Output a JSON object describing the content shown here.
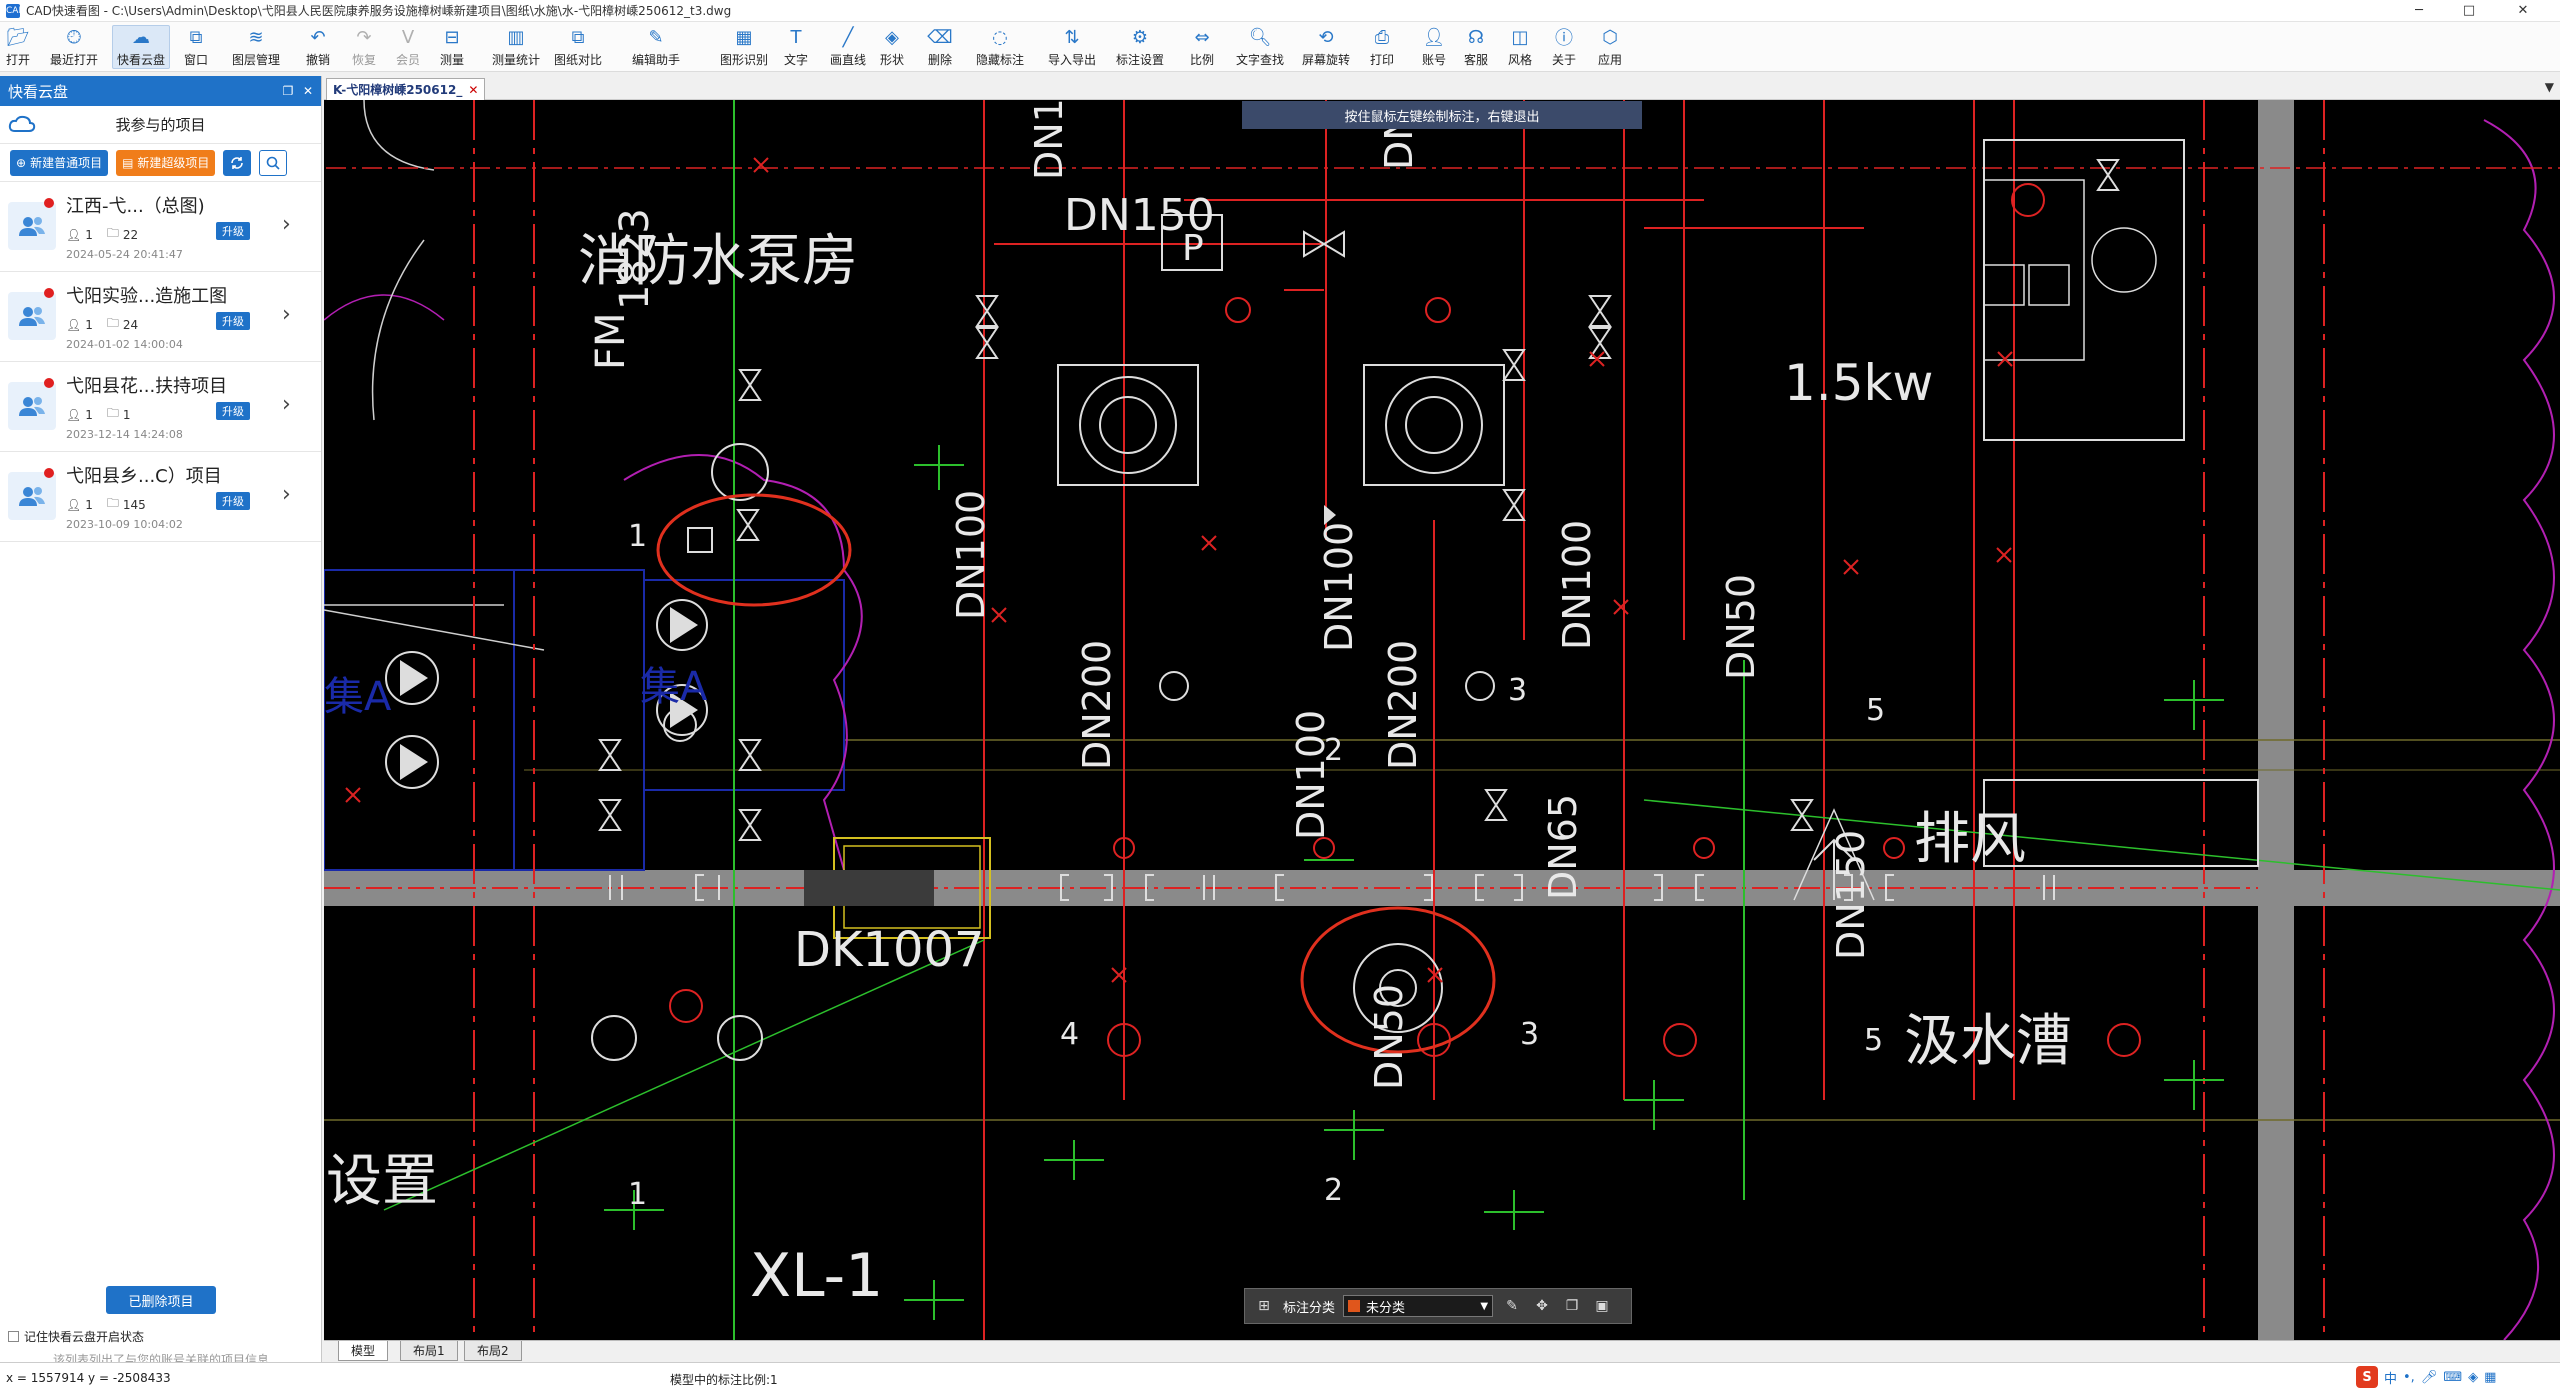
{
  "window": {
    "title": "CAD快速看图 - C:\\Users\\Admin\\Desktop\\弋阳县人民医院康养服务设施樟树嵊新建项目\\图纸\\水施\\水-弋阳樟树嵊250612_t3.dwg",
    "minimize": "─",
    "maximize": "□",
    "close": "✕"
  },
  "toolbar": [
    {
      "label": "打开",
      "icon": "open-folder-icon"
    },
    {
      "label": "最近打开",
      "icon": "recent-clock-icon"
    },
    {
      "label": "快看云盘",
      "icon": "cloud-icon",
      "active": true
    },
    {
      "label": "窗口",
      "icon": "window-icon"
    },
    {
      "label": "图层管理",
      "icon": "layers-icon"
    },
    {
      "label": "撤销",
      "icon": "undo-icon"
    },
    {
      "label": "恢复",
      "icon": "redo-icon",
      "disabled": true
    },
    {
      "label": "会员",
      "icon": "vip-icon",
      "disabled": true
    },
    {
      "label": "测量",
      "icon": "measure-icon"
    },
    {
      "label": "测量统计",
      "icon": "measure-stats-icon"
    },
    {
      "label": "图纸对比",
      "icon": "compare-icon"
    },
    {
      "label": "编辑助手",
      "icon": "edit-assistant-icon"
    },
    {
      "label": "图形识别",
      "icon": "shape-recognition-icon"
    },
    {
      "label": "文字",
      "icon": "text-icon"
    },
    {
      "label": "画直线",
      "icon": "line-icon"
    },
    {
      "label": "形状",
      "icon": "shape-icon"
    },
    {
      "label": "删除",
      "icon": "eraser-icon"
    },
    {
      "label": "隐藏标注",
      "icon": "hide-annotation-icon"
    },
    {
      "label": "导入导出",
      "icon": "import-export-icon"
    },
    {
      "label": "标注设置",
      "icon": "annotation-settings-icon"
    },
    {
      "label": "比例",
      "icon": "scale-icon"
    },
    {
      "label": "文字查找",
      "icon": "text-search-icon"
    },
    {
      "label": "屏幕旋转",
      "icon": "rotate-screen-icon"
    },
    {
      "label": "打印",
      "icon": "print-icon"
    },
    {
      "label": "账号",
      "icon": "account-icon"
    },
    {
      "label": "客服",
      "icon": "headset-icon"
    },
    {
      "label": "风格",
      "icon": "style-icon"
    },
    {
      "label": "关于",
      "icon": "info-icon"
    },
    {
      "label": "应用",
      "icon": "apps-cube-icon"
    }
  ],
  "cloud_panel": {
    "header": "快看云盘",
    "subtitle": "我参与的项目",
    "new_normal": "新建普通项目",
    "new_super": "新建超级项目",
    "projects": [
      {
        "name": "江西-弋...（总图)",
        "members": "1",
        "files": "22",
        "upgrade": "升级",
        "date": "2024-05-24 20:41:47"
      },
      {
        "name": "弋阳实验...造施工图",
        "members": "1",
        "files": "24",
        "upgrade": "升级",
        "date": "2024-01-02 14:00:04"
      },
      {
        "name": "弋阳县花...扶持项目",
        "members": "1",
        "files": "1",
        "upgrade": "升级",
        "date": "2023-12-14 14:24:08"
      },
      {
        "name": "弋阳县乡...C）项目",
        "members": "1",
        "files": "145",
        "upgrade": "升级",
        "date": "2023-10-09 10:04:02"
      }
    ],
    "deleted_projects": "已删除项目",
    "remember": "记住快看云盘开启状态",
    "hint": "该列表列出了与您的账号关联的项目信息"
  },
  "document_tab": {
    "label": "K-弋阳樟树嵊250612_",
    "close": "✕"
  },
  "canvas": {
    "tooltip": "按住鼠标左键绘制标注，右键退出",
    "labels": {
      "dn150_top": "DN150",
      "fm": "FM",
      "num_1823": "1823",
      "pump_room": "消防水泵房",
      "kw": "1.5kw",
      "dn100_a": "DN100",
      "dn100_b": "DN100",
      "dn100_c": "DN100",
      "dn100_d": "DN100",
      "dn50_a": "DN50",
      "dn50_b": "DN50",
      "dn200_a": "DN200",
      "dn200_b": "DN200",
      "dn65": "DN65",
      "dn150_b": "DN150",
      "dn_top1": "DN1",
      "dn_top2": "DN",
      "dk": "DK1007",
      "exhaust": "排风",
      "sump": "汲水漕",
      "setup": "设置",
      "xl": "XL-1",
      "jia_a": "集A",
      "jia_b": "集A",
      "p": "P",
      "n1": "1",
      "n2": "2",
      "n3": "3",
      "n3b": "3",
      "n4": "4",
      "n5": "5",
      "n5b": "5",
      "n1b": "1",
      "n2b": "2"
    },
    "annotation_bar": {
      "label": "标注分类",
      "value": "未分类"
    }
  },
  "layout_tabs": [
    "模型",
    "布局1",
    "布局2"
  ],
  "status": {
    "coords": "x = 1557914  y = -2508433",
    "scale": "模型中的标注比例:1",
    "ime": "中"
  },
  "colors": {
    "accent": "#1f72c8",
    "orange": "#f07d1a",
    "canvas_bg": "#000000",
    "annotation_red": "#e0301e"
  }
}
